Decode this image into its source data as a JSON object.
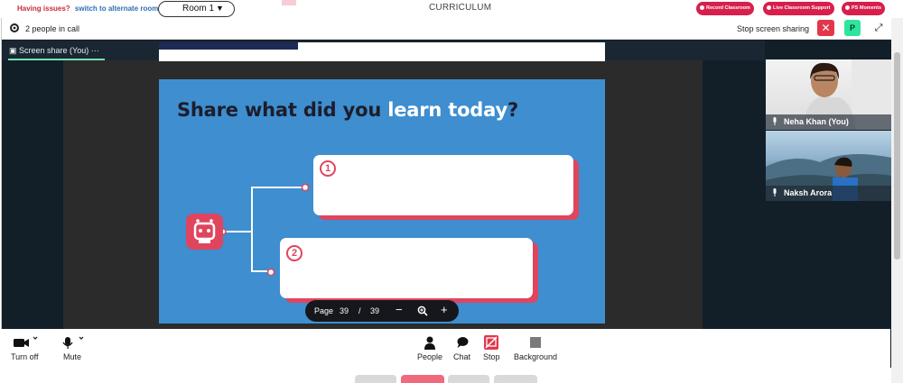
{
  "topbar": {
    "issue_text": "Having issues?",
    "alt_room_link": "switch to alternate room",
    "room_label": "Room 1",
    "room_caret": "▼",
    "center_title": "CURRICULUM",
    "buttons": [
      "Record Classroom",
      "Live Classroom Support",
      "PS Moments"
    ]
  },
  "call_header": {
    "people_count": "2 people in call",
    "stop_share": "Stop screen sharing",
    "close_glyph": "✕",
    "presenter_badge": "P",
    "expand_glyph": "⤢"
  },
  "share_tab": {
    "label": "Screen share (You)",
    "menu_glyph": "···"
  },
  "slide": {
    "title_dark": "Share what did you",
    "title_light": "learn today",
    "title_end": "?",
    "card1_number": "1",
    "card2_number": "2"
  },
  "zoom_bar": {
    "page_label": "Page",
    "current_page": "39",
    "separator": "/",
    "total_pages": "39",
    "zoom_out": "−",
    "zoom_in": "+"
  },
  "participants": [
    {
      "name": "Neha Khan (You)"
    },
    {
      "name": "Naksh Arora"
    }
  ],
  "controls": {
    "camera": "Turn off",
    "mic": "Mute",
    "people": "People",
    "chat": "Chat",
    "stop": "Stop",
    "background": "Background"
  },
  "colors": {
    "accent_red": "#d81f4c",
    "slide_blue": "#3e8ed0",
    "presenter_green": "#2ee59d",
    "dark_bg": "#121f29"
  }
}
